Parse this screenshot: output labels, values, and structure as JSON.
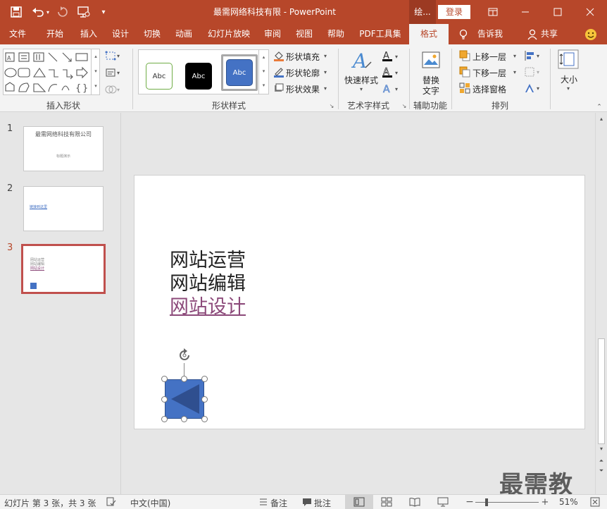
{
  "window": {
    "title": "最需网络科技有限  -  PowerPoint",
    "drawing_tab": "绘...",
    "login_label": "登录"
  },
  "colors": {
    "accent": "#b7472a",
    "shape_fill": "#4472c4",
    "shape_triangle": "#2f4f8f",
    "link_text": "#8c4a7a"
  },
  "tabs": [
    "文件",
    "开始",
    "插入",
    "设计",
    "切换",
    "动画",
    "幻灯片放映",
    "审阅",
    "视图",
    "帮助",
    "PDF工具集",
    "格式"
  ],
  "tell_me": "告诉我",
  "share": "共享",
  "ribbon": {
    "insert_shapes_label": "插入形状",
    "shape_styles_label": "形状样式",
    "style_sample": "Abc",
    "shape_fill": "形状填充",
    "shape_outline": "形状轮廓",
    "shape_effects": "形状效果",
    "wordart_quick": "快速样式",
    "wordart_label": "艺术字样式",
    "alt_text_1": "替换",
    "alt_text_2": "文字",
    "accessibility_label": "辅助功能",
    "bring_forward": "上移一层",
    "send_backward": "下移一层",
    "selection_pane": "选择窗格",
    "arrange_label": "排列",
    "size_label": "大小"
  },
  "slides": [
    {
      "number": "1",
      "title": "最需网络科技有限公司",
      "subtitle": "标题演示"
    },
    {
      "number": "2",
      "link": "链接到这里"
    },
    {
      "number": "3",
      "lines": [
        "网站运营",
        "网站编辑",
        "网站设计"
      ]
    }
  ],
  "current_slide": {
    "line1": "网站运营",
    "line2": "网站编辑",
    "line3": "网站设计"
  },
  "status": {
    "slide_info": "幻灯片 第 3 张，共 3 张",
    "language": "中文(中国)",
    "notes": "备注",
    "comments": "批注",
    "zoom": "51%"
  },
  "watermark": "最需教育"
}
